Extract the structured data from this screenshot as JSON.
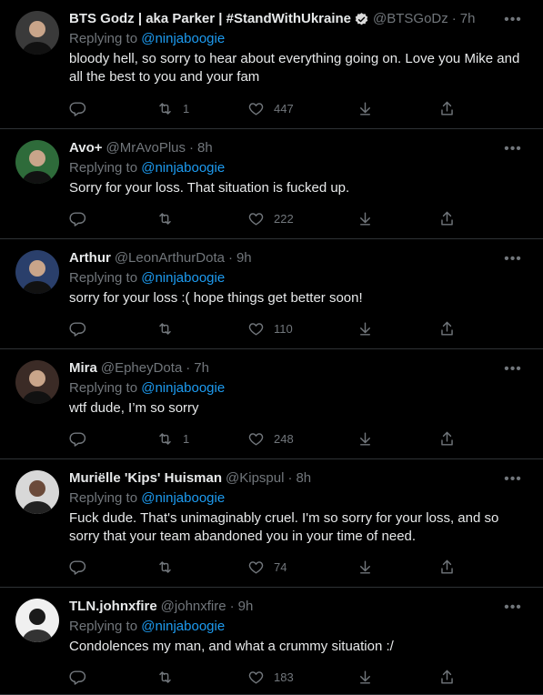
{
  "reply_prefix": "Replying to",
  "tweets": [
    {
      "name": "BTS Godz | aka Parker | #StandWithUkraine",
      "verified": true,
      "handle": "@BTSGoDz",
      "dot": "·",
      "time": "7h",
      "mention": "@ninjaboogie",
      "text": "bloody hell, so sorry to hear about everything going on. Love you Mike and all the best to you and your fam",
      "retweets": "1",
      "likes": "447",
      "avatar_color": "#3a3a3a"
    },
    {
      "name": "Avo+",
      "verified": false,
      "handle": "@MrAvoPlus",
      "dot": "·",
      "time": "8h",
      "mention": "@ninjaboogie",
      "text": "Sorry for your loss. That situation is fucked up.",
      "retweets": "",
      "likes": "222",
      "avatar_color": "#2e6b3a"
    },
    {
      "name": "Arthur",
      "verified": false,
      "handle": "@LeonArthurDota",
      "dot": "·",
      "time": "9h",
      "mention": "@ninjaboogie",
      "text": "sorry for your loss :(  hope things get better soon!",
      "retweets": "",
      "likes": "110",
      "avatar_color": "#2a3f6b"
    },
    {
      "name": "Mira",
      "verified": false,
      "handle": "@EpheyDota",
      "dot": "·",
      "time": "7h",
      "mention": "@ninjaboogie",
      "text": "wtf dude, I’m so sorry",
      "retweets": "1",
      "likes": "248",
      "avatar_color": "#3b2b26"
    },
    {
      "name": "Muriëlle 'Kips' Huisman",
      "verified": false,
      "handle": "@Kipspul",
      "dot": "·",
      "time": "8h",
      "mention": "@ninjaboogie",
      "text": "Fuck dude. That's unimaginably cruel. I'm so sorry for your loss, and so sorry that your team abandoned you in your time of need.",
      "retweets": "",
      "likes": "74",
      "avatar_color": "#d8d8d8"
    },
    {
      "name": "TLN.johnxfire",
      "verified": false,
      "handle": "@johnxfire",
      "dot": "·",
      "time": "9h",
      "mention": "@ninjaboogie",
      "text": "Condolences my man, and what a crummy situation :/",
      "retweets": "",
      "likes": "183",
      "avatar_color": "#f0f0f0"
    }
  ],
  "colors": {
    "background": "#000000",
    "text": "#e7e9ea",
    "muted": "#71767b",
    "link": "#1d9bf0",
    "verified": "#d9d9d9",
    "divider": "#2f3336"
  },
  "icons": [
    "reply-icon",
    "retweet-icon",
    "like-icon",
    "reaction-icon",
    "share-icon",
    "more-icon",
    "verified-badge-icon"
  ]
}
